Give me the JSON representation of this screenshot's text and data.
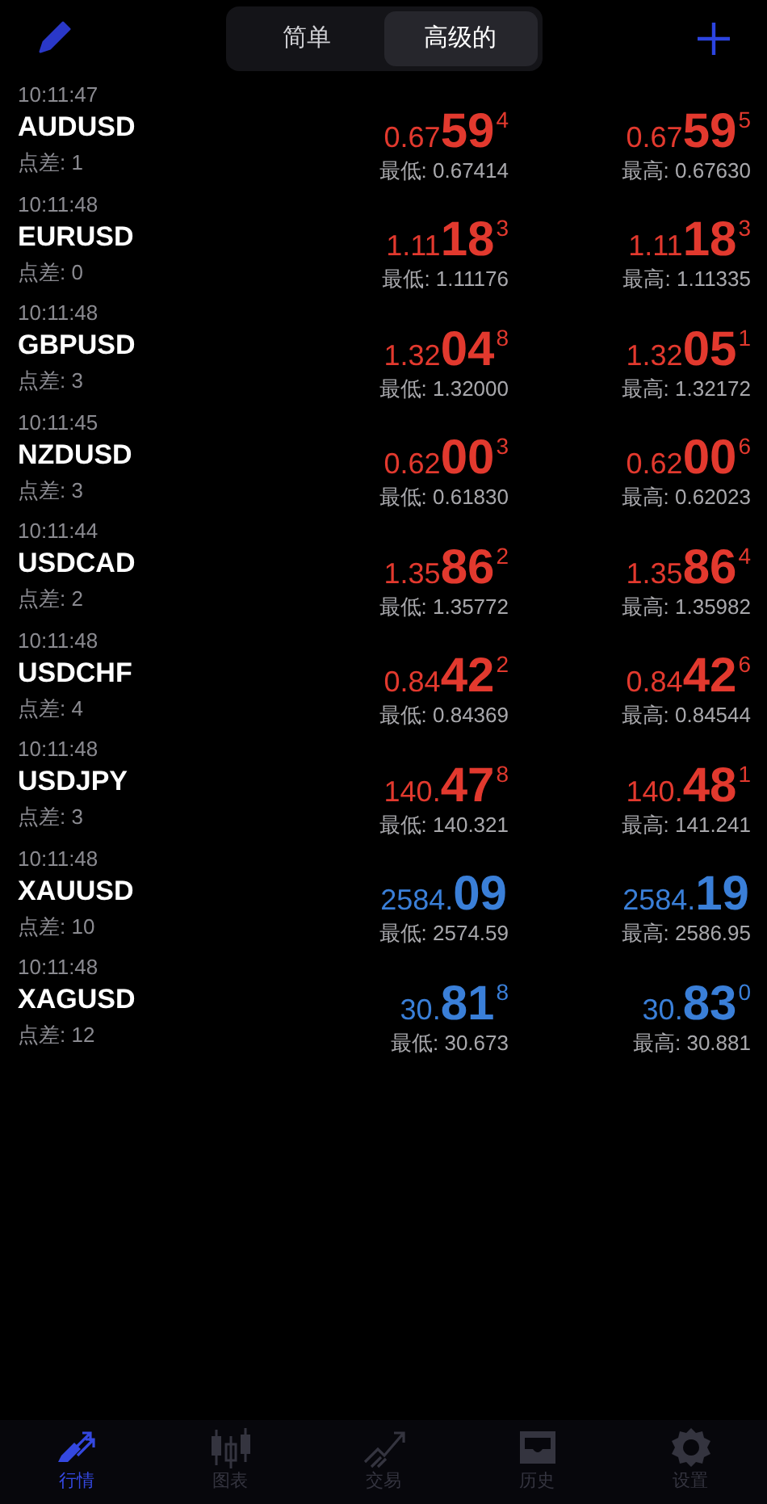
{
  "segments": [
    {
      "label": "简单",
      "selected": false
    },
    {
      "label": "高级的",
      "selected": true
    }
  ],
  "quotes": [
    {
      "time": "10:11:47",
      "symbol": "AUDUSD",
      "spread": "点差: 1",
      "color": "#e2392e",
      "bid": {
        "prefix": "0.67",
        "big": "59",
        "sup": "4"
      },
      "low": "最低: 0.67414",
      "ask": {
        "prefix": "0.67",
        "big": "59",
        "sup": "5"
      },
      "high": "最高: 0.67630"
    },
    {
      "time": "10:11:48",
      "symbol": "EURUSD",
      "spread": "点差: 0",
      "color": "#e2392e",
      "bid": {
        "prefix": "1.11",
        "big": "18",
        "sup": "3"
      },
      "low": "最低: 1.11176",
      "ask": {
        "prefix": "1.11",
        "big": "18",
        "sup": "3"
      },
      "high": "最高: 1.11335"
    },
    {
      "time": "10:11:48",
      "symbol": "GBPUSD",
      "spread": "点差: 3",
      "color": "#e2392e",
      "bid": {
        "prefix": "1.32",
        "big": "04",
        "sup": "8"
      },
      "low": "最低: 1.32000",
      "ask": {
        "prefix": "1.32",
        "big": "05",
        "sup": "1"
      },
      "high": "最高: 1.32172"
    },
    {
      "time": "10:11:45",
      "symbol": "NZDUSD",
      "spread": "点差: 3",
      "color": "#e2392e",
      "bid": {
        "prefix": "0.62",
        "big": "00",
        "sup": "3"
      },
      "low": "最低: 0.61830",
      "ask": {
        "prefix": "0.62",
        "big": "00",
        "sup": "6"
      },
      "high": "最高: 0.62023"
    },
    {
      "time": "10:11:44",
      "symbol": "USDCAD",
      "spread": "点差: 2",
      "color": "#e2392e",
      "bid": {
        "prefix": "1.35",
        "big": "86",
        "sup": "2"
      },
      "low": "最低: 1.35772",
      "ask": {
        "prefix": "1.35",
        "big": "86",
        "sup": "4"
      },
      "high": "最高: 1.35982"
    },
    {
      "time": "10:11:48",
      "symbol": "USDCHF",
      "spread": "点差: 4",
      "color": "#e2392e",
      "bid": {
        "prefix": "0.84",
        "big": "42",
        "sup": "2"
      },
      "low": "最低: 0.84369",
      "ask": {
        "prefix": "0.84",
        "big": "42",
        "sup": "6"
      },
      "high": "最高: 0.84544"
    },
    {
      "time": "10:11:48",
      "symbol": "USDJPY",
      "spread": "点差: 3",
      "color": "#e2392e",
      "bid": {
        "prefix": "140.",
        "big": "47",
        "sup": "8"
      },
      "low": "最低: 140.321",
      "ask": {
        "prefix": "140.",
        "big": "48",
        "sup": "1"
      },
      "high": "最高: 141.241"
    },
    {
      "time": "10:11:48",
      "symbol": "XAUUSD",
      "spread": "点差: 10",
      "color": "#3a7fd8",
      "bid": {
        "prefix": "2584.",
        "big": "09"
      },
      "low": "最低: 2574.59",
      "ask": {
        "prefix": "2584.",
        "big": "19"
      },
      "high": "最高: 2586.95"
    },
    {
      "time": "10:11:48",
      "symbol": "XAGUSD",
      "spread": "点差: 12",
      "color": "#3a7fd8",
      "bid": {
        "prefix": "30.",
        "big": "81",
        "sup": "8"
      },
      "low": "最低: 30.673",
      "ask": {
        "prefix": "30.",
        "big": "83",
        "sup": "0"
      },
      "high": "最高: 30.881"
    }
  ],
  "tab_bar": [
    {
      "label": "行情",
      "selected": true
    },
    {
      "label": "图表",
      "selected": false
    },
    {
      "label": "交易",
      "selected": false
    },
    {
      "label": "历史",
      "selected": false
    },
    {
      "label": "设置",
      "selected": false
    }
  ]
}
